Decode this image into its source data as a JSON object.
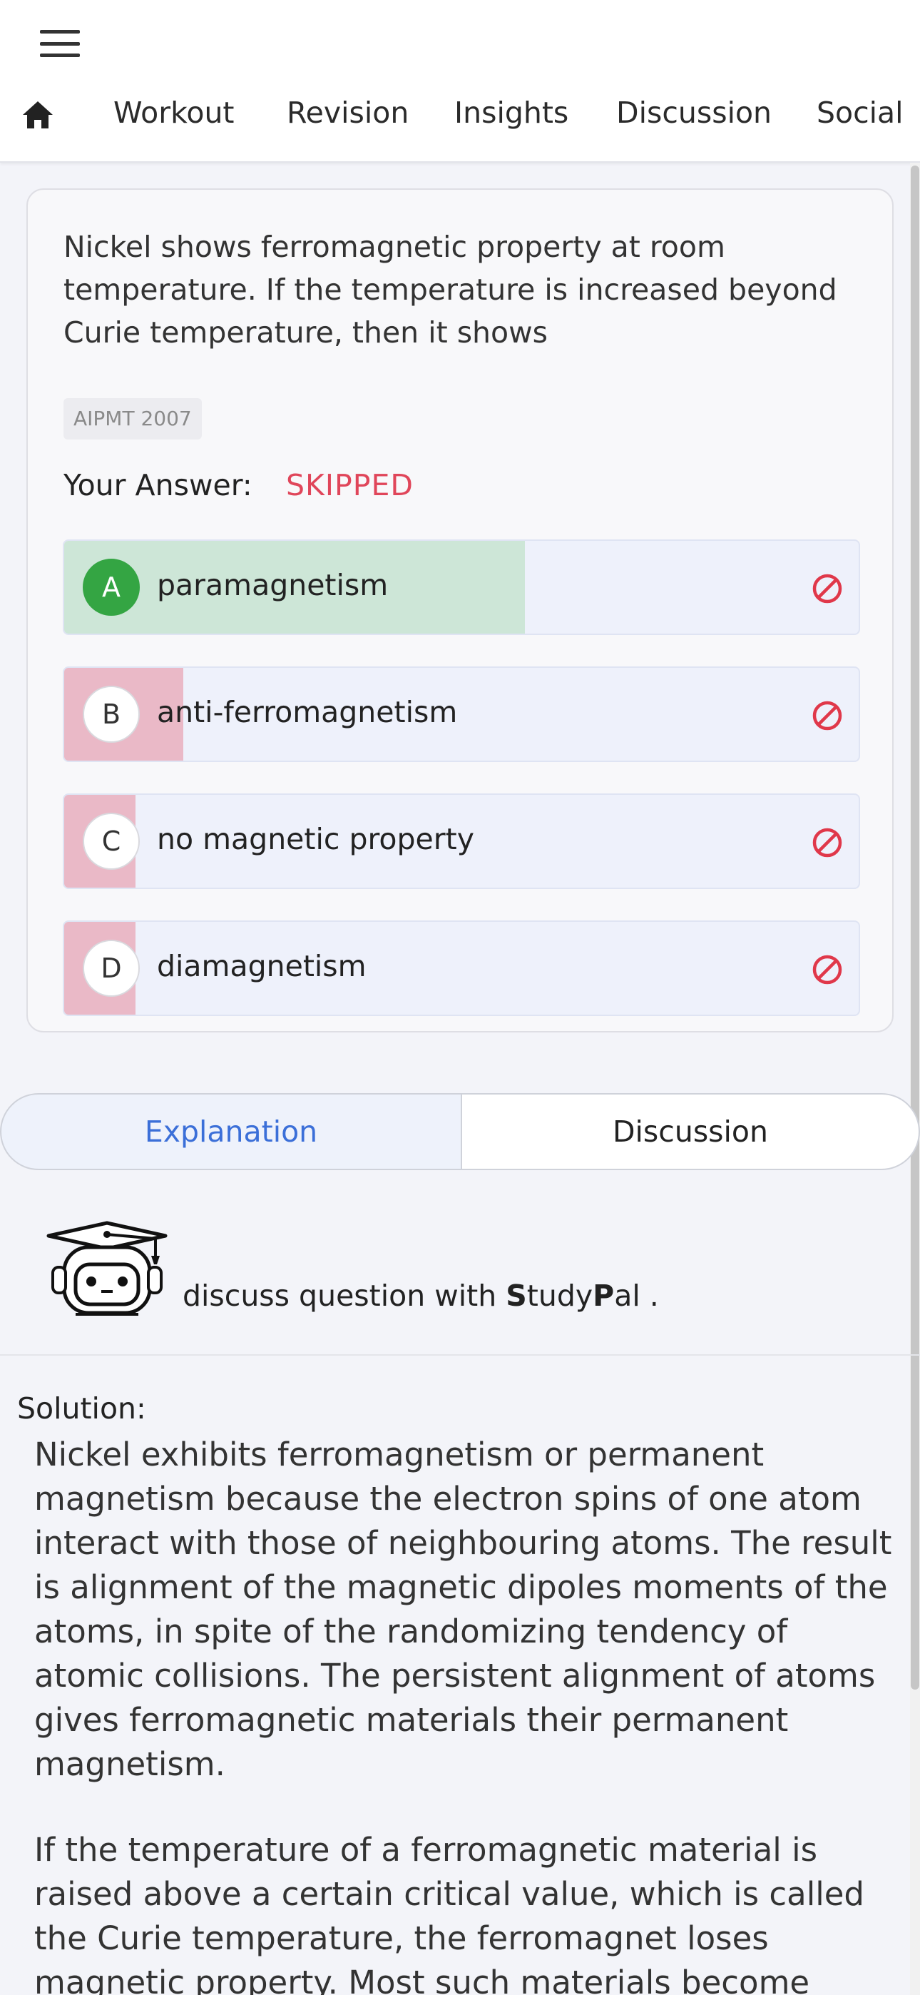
{
  "nav": {
    "items": [
      "Workout",
      "Revision",
      "Insights",
      "Discussion",
      "Social"
    ]
  },
  "question": {
    "text": "Nickel shows ferromagnetic property at room temperature. If the temperature is increased beyond Curie temperature, then it shows",
    "tag": "AIPMT 2007",
    "your_answer_label": "Your Answer:",
    "your_answer_value": "SKIPPED",
    "options": [
      {
        "letter": "A",
        "text": "paramagnetism",
        "correct": true,
        "response_share": 0.58
      },
      {
        "letter": "B",
        "text": "anti-ferromagnetism",
        "correct": false,
        "response_share": 0.15
      },
      {
        "letter": "C",
        "text": "no magnetic property",
        "correct": false,
        "response_share": 0.09
      },
      {
        "letter": "D",
        "text": "diamagnetism",
        "correct": false,
        "response_share": 0.09
      }
    ]
  },
  "tabs": {
    "explanation": "Explanation",
    "discussion": "Discussion"
  },
  "studypal": {
    "prefix": "discuss question with ",
    "brand_s": "S",
    "brand_tudy": "tudy",
    "brand_p": "P",
    "brand_al": "al",
    "suffix": " ."
  },
  "solution": {
    "label": "Solution:",
    "paragraph1": "Nickel exhibits ferromagnetism or permanent magnetism because the electron spins of one atom interact with those of neighbouring atoms. The result is alignment of the magnetic dipoles moments of the atoms, in spite of the randomizing tendency of atomic collisions. The persistent alignment of atoms gives ferromagnetic materials their permanent magnetism.",
    "paragraph2": "If the temperature of a ferromagnetic material is raised above a certain critical value, which is called the Curie temperature, the ferromagnet loses magnetic property. Most such materials become"
  },
  "colors": {
    "correct": "#34a543",
    "correct_fill": "#cde6d7",
    "wrong_fill": "#eab9c7",
    "skipped": "#e0465a",
    "active_tab": "#3b6fd8"
  },
  "icons": {
    "menu": "hamburger-icon",
    "home": "home-icon",
    "option_status": "prohibited-icon",
    "studypal": "robot-graduate-icon"
  }
}
